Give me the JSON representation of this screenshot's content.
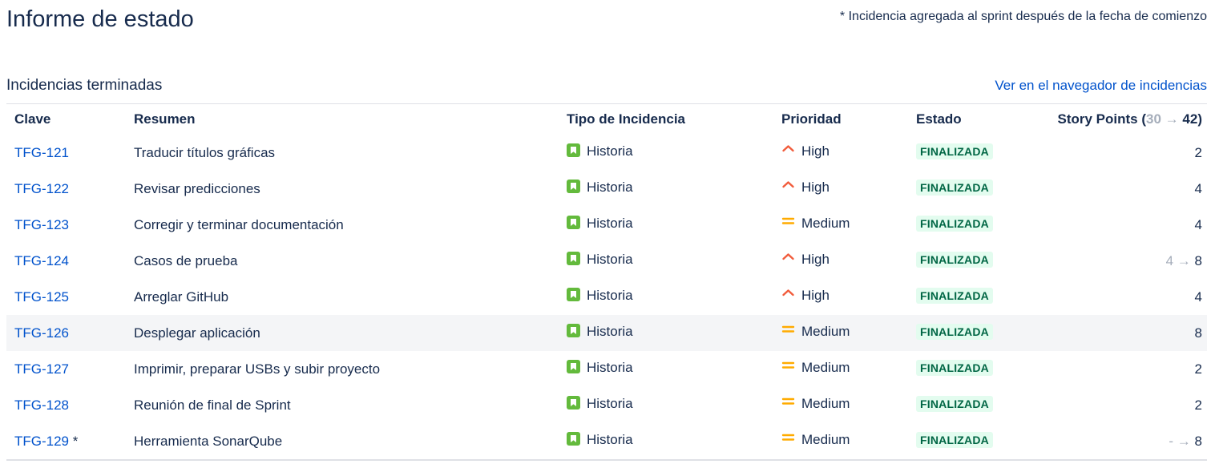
{
  "header": {
    "title": "Informe de estado",
    "note": "* Incidencia agregada al sprint después de la fecha de comienzo"
  },
  "section": {
    "title": "Incidencias terminadas",
    "link": "Ver en el navegador de incidencias"
  },
  "table": {
    "columns": {
      "key": "Clave",
      "summary": "Resumen",
      "type": "Tipo de Incidencia",
      "priority": "Prioridad",
      "status": "Estado",
      "points_label": "Story Points (",
      "points_from": "30",
      "arrow": "→",
      "points_to": "42",
      "points_close": ")"
    },
    "rows": [
      {
        "key": "TFG-121",
        "added": "",
        "summary": "Traducir títulos gráficas",
        "type": "Historia",
        "priority": "High",
        "status": "FINALIZADA",
        "points_old": "",
        "points_arrow": "",
        "points": "2"
      },
      {
        "key": "TFG-122",
        "added": "",
        "summary": "Revisar predicciones",
        "type": "Historia",
        "priority": "High",
        "status": "FINALIZADA",
        "points_old": "",
        "points_arrow": "",
        "points": "4"
      },
      {
        "key": "TFG-123",
        "added": "",
        "summary": "Corregir y terminar documentación",
        "type": "Historia",
        "priority": "Medium",
        "status": "FINALIZADA",
        "points_old": "",
        "points_arrow": "",
        "points": "4"
      },
      {
        "key": "TFG-124",
        "added": "",
        "summary": "Casos de prueba",
        "type": "Historia",
        "priority": "High",
        "status": "FINALIZADA",
        "points_old": "4",
        "points_arrow": " → ",
        "points": "8"
      },
      {
        "key": "TFG-125",
        "added": "",
        "summary": "Arreglar GitHub",
        "type": "Historia",
        "priority": "High",
        "status": "FINALIZADA",
        "points_old": "",
        "points_arrow": "",
        "points": "4"
      },
      {
        "key": "TFG-126",
        "added": "",
        "summary": "Desplegar aplicación",
        "type": "Historia",
        "priority": "Medium",
        "status": "FINALIZADA",
        "points_old": "",
        "points_arrow": "",
        "points": "8"
      },
      {
        "key": "TFG-127",
        "added": "",
        "summary": "Imprimir, preparar USBs y subir proyecto",
        "type": "Historia",
        "priority": "Medium",
        "status": "FINALIZADA",
        "points_old": "",
        "points_arrow": "",
        "points": "2"
      },
      {
        "key": "TFG-128",
        "added": "",
        "summary": "Reunión de final de Sprint",
        "type": "Historia",
        "priority": "Medium",
        "status": "FINALIZADA",
        "points_old": "",
        "points_arrow": "",
        "points": "2"
      },
      {
        "key": "TFG-129",
        "added": " *",
        "summary": "Herramienta SonarQube",
        "type": "Historia",
        "priority": "Medium",
        "status": "FINALIZADA",
        "points_old": "-",
        "points_arrow": " → ",
        "points": "8"
      }
    ]
  },
  "icons": {
    "type": "story-icon",
    "priority_high": "priority-high-icon",
    "priority_medium": "priority-medium-icon"
  },
  "colors": {
    "link": "#0052cc",
    "story": "#63ba3c",
    "high": "#f15c3c",
    "medium": "#ffab00",
    "done_bg": "#e3fcef",
    "done_text": "#006644",
    "muted": "#a5adba"
  }
}
